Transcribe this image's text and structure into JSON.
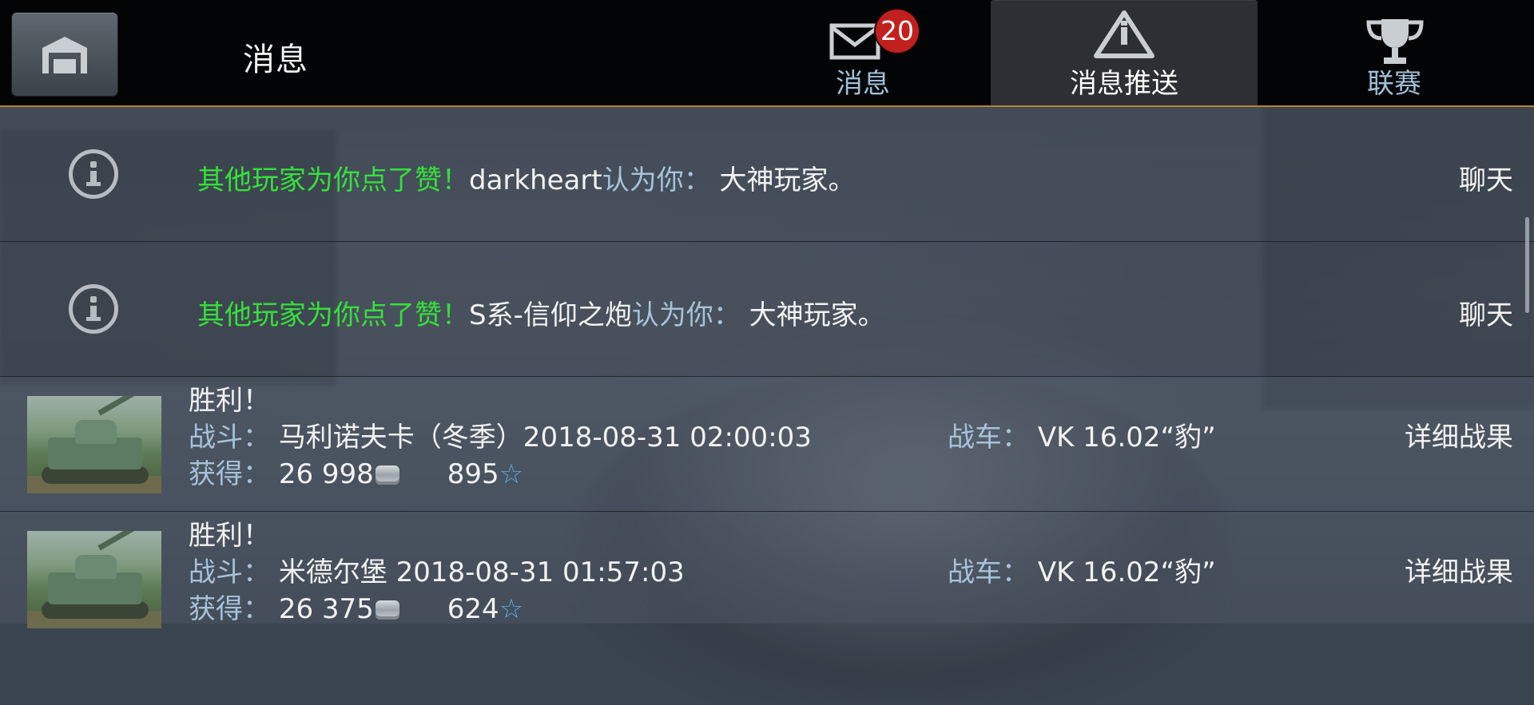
{
  "header": {
    "title": "消息",
    "tabs": [
      {
        "label": "消息",
        "badge": "20",
        "icon": "envelope-icon"
      },
      {
        "label": "消息推送",
        "icon": "warning-triangle-icon",
        "selected": true
      },
      {
        "label": "联赛",
        "icon": "trophy-icon"
      }
    ]
  },
  "colors": {
    "accent_line": "#b9832e",
    "green_text": "#36e03a",
    "blue_label": "#a6c3da",
    "badge_red": "#c21f1f"
  },
  "messages": [
    {
      "type": "like",
      "prefix": "其他玩家为你点了赞！",
      "player": "darkheart",
      "verb": "认为你：",
      "title": "大神玩家。",
      "action": "聊天"
    },
    {
      "type": "like",
      "prefix": "其他玩家为你点了赞！",
      "player": "S系-信仰之炮",
      "verb": "认为你：",
      "title": "大神玩家。",
      "action": "聊天"
    },
    {
      "type": "battle",
      "result": "胜利！",
      "battle_label": "战斗：",
      "battle_value": "马利诺夫卡（冬季）2018-08-31 02:00:03",
      "earned_label": "获得：",
      "credits": "26 998",
      "xp": "895",
      "tank_label": "战车：",
      "tank_value": "VK 16.02“豹”",
      "action": "详细战果"
    },
    {
      "type": "battle",
      "result": "胜利！",
      "battle_label": "战斗：",
      "battle_value": "米德尔堡 2018-08-31 01:57:03",
      "earned_label": "获得：",
      "credits": "26 375",
      "xp": "624",
      "tank_label": "战车：",
      "tank_value": "VK 16.02“豹”",
      "action": "详细战果"
    }
  ]
}
